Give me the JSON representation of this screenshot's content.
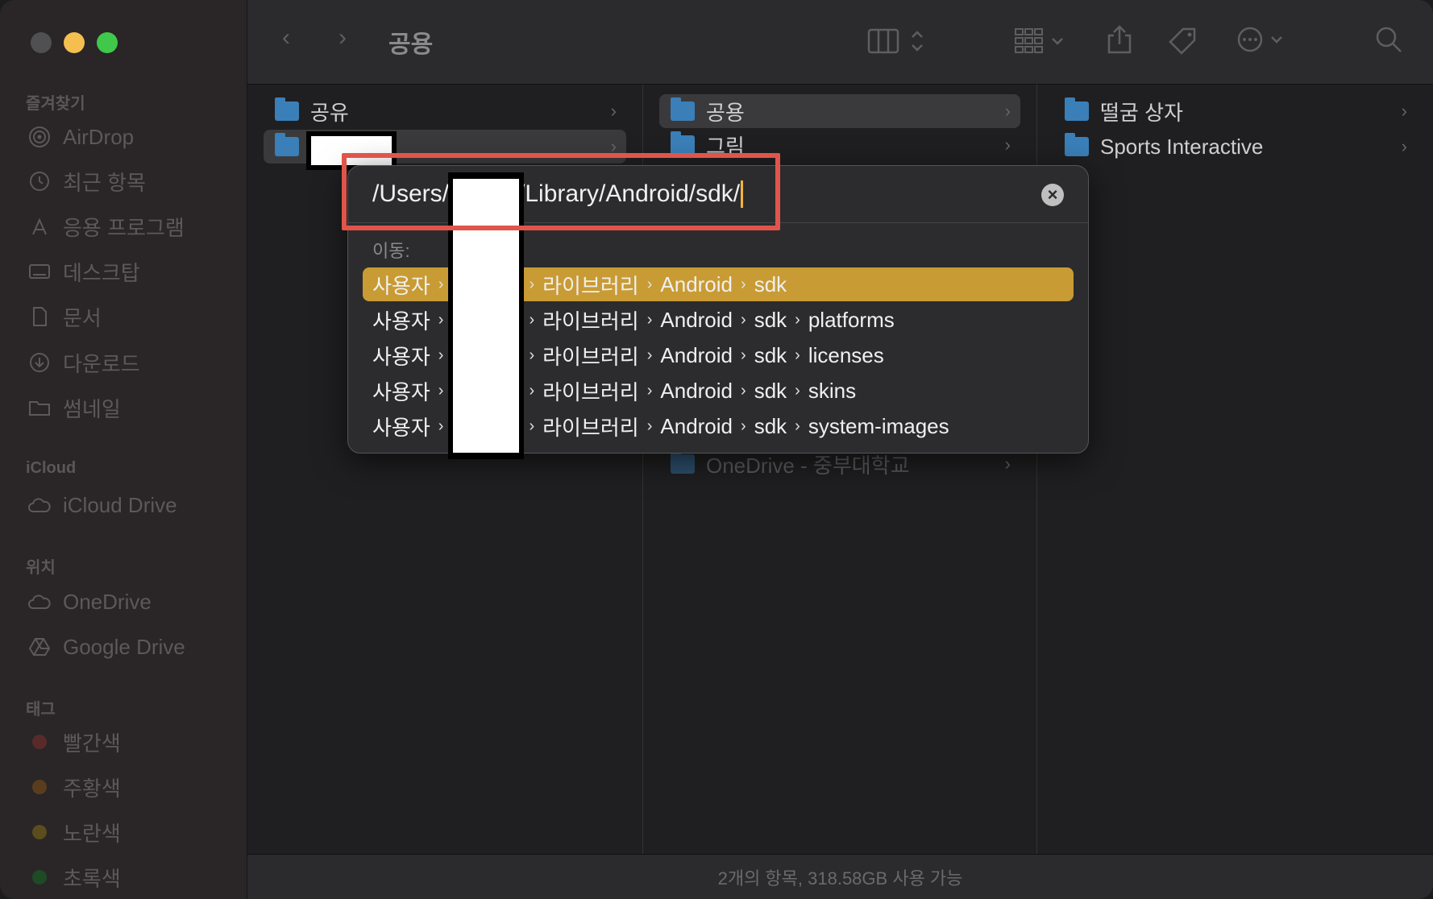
{
  "toolbar": {
    "title": "공용"
  },
  "sidebar": {
    "favorites_label": "즐겨찾기",
    "favorites": [
      {
        "label": "AirDrop",
        "icon": "airdrop-icon"
      },
      {
        "label": "최근 항목",
        "icon": "clock-icon"
      },
      {
        "label": "응용 프로그램",
        "icon": "applications-icon"
      },
      {
        "label": "데스크탑",
        "icon": "desktop-icon"
      },
      {
        "label": "문서",
        "icon": "document-icon"
      },
      {
        "label": "다운로드",
        "icon": "download-icon"
      },
      {
        "label": "썸네일",
        "icon": "folder-icon"
      }
    ],
    "icloud_label": "iCloud",
    "icloud": [
      {
        "label": "iCloud Drive",
        "icon": "cloud-icon"
      }
    ],
    "locations_label": "위치",
    "locations": [
      {
        "label": "OneDrive",
        "icon": "cloud-icon"
      },
      {
        "label": "Google Drive",
        "icon": "google-drive-icon"
      }
    ],
    "tags_label": "태그",
    "tags": [
      {
        "label": "빨간색",
        "color": "#5a2a2a"
      },
      {
        "label": "주황색",
        "color": "#5a3d1e"
      },
      {
        "label": "노란색",
        "color": "#5a4d1e"
      },
      {
        "label": "초록색",
        "color": "#1e4a26"
      }
    ]
  },
  "columns": {
    "col1": [
      {
        "label": "공유"
      },
      {
        "label": ""
      }
    ],
    "col2": [
      {
        "label": "공용"
      },
      {
        "label": "그림"
      },
      {
        "label": "OneDrive - 중부대학교"
      }
    ],
    "col3": [
      {
        "label": "떨굼 상자"
      },
      {
        "label": "Sports Interactive"
      }
    ]
  },
  "dialog": {
    "path_prefix": "/Users/",
    "path_suffix": "/Library/Android/sdk/",
    "goto_label": "이동:",
    "suggestions": [
      {
        "user": "사용자",
        "lib": "라이브러리",
        "android": "Android",
        "sdk": "sdk",
        "tail": ""
      },
      {
        "user": "사용자",
        "lib": "라이브러리",
        "android": "Android",
        "sdk": "sdk",
        "tail": "platforms"
      },
      {
        "user": "사용자",
        "lib": "라이브러리",
        "android": "Android",
        "sdk": "sdk",
        "tail": "licenses"
      },
      {
        "user": "사용자",
        "lib": "라이브러리",
        "android": "Android",
        "sdk": "sdk",
        "tail": "skins"
      },
      {
        "user": "사용자",
        "lib": "라이브러리",
        "android": "Android",
        "sdk": "sdk",
        "tail": "system-images"
      }
    ]
  },
  "status": {
    "text": "2개의 항목, 318.58GB 사용 가능"
  }
}
